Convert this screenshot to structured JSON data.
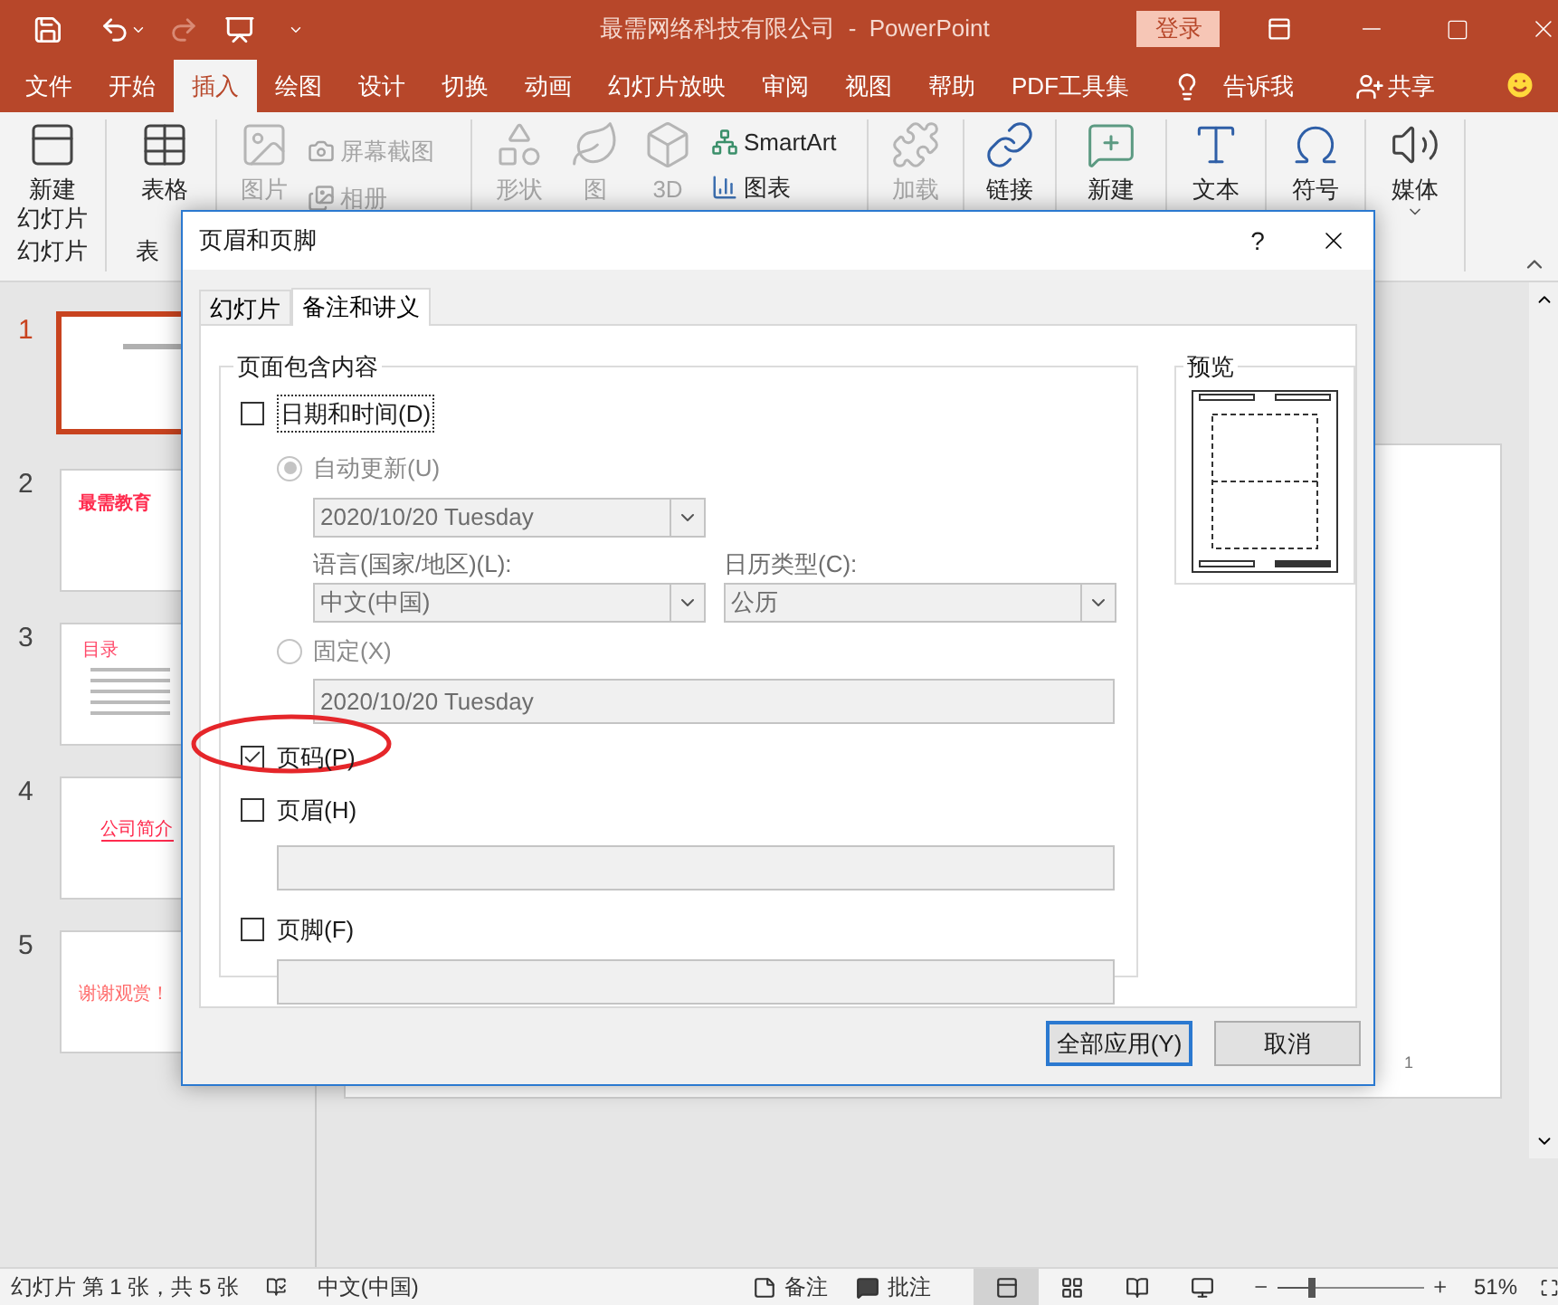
{
  "window": {
    "title": "最需网络科技有限公司  -  PowerPoint",
    "login_button": "登录"
  },
  "menu_tabs": [
    {
      "label": "文件",
      "selected": false
    },
    {
      "label": "开始",
      "selected": false
    },
    {
      "label": "插入",
      "selected": true
    },
    {
      "label": "绘图",
      "selected": false
    },
    {
      "label": "设计",
      "selected": false
    },
    {
      "label": "切换",
      "selected": false
    },
    {
      "label": "动画",
      "selected": false
    },
    {
      "label": "幻灯片放映",
      "selected": false
    },
    {
      "label": "审阅",
      "selected": false
    },
    {
      "label": "视图",
      "selected": false
    },
    {
      "label": "帮助",
      "selected": false
    },
    {
      "label": "PDF工具集",
      "selected": false
    }
  ],
  "tell_me": "告诉我",
  "share": "共享",
  "ribbon": {
    "new_slide": {
      "label": "新建",
      "sublabel": "幻灯片",
      "disabled": false
    },
    "slides_group": "幻灯片",
    "table": {
      "label": "表格",
      "disabled": false
    },
    "table_group": "表",
    "picture": {
      "label": "图片",
      "disabled": true
    },
    "screenshot": {
      "label": "屏幕截图",
      "disabled": true
    },
    "album": {
      "label": "相册",
      "disabled": true
    },
    "shapes": {
      "label": "形状",
      "disabled": true
    },
    "icons": {
      "label": "图",
      "disabled": true
    },
    "models": {
      "label": "3D",
      "disabled": true
    },
    "smartart": {
      "label": "SmartArt",
      "disabled": false
    },
    "chart": {
      "label": "图表",
      "disabled": false
    },
    "addins": {
      "label": "加载",
      "disabled": true
    },
    "link": {
      "label": "链接",
      "disabled": false
    },
    "comment": {
      "label": "新建",
      "disabled": false
    },
    "text": {
      "label": "文本",
      "disabled": false
    },
    "symbol": {
      "label": "符号",
      "disabled": false
    },
    "media": {
      "label": "媒体",
      "disabled": false
    }
  },
  "slides": [
    {
      "number": "1",
      "selected": true,
      "kind": "cover"
    },
    {
      "number": "2",
      "selected": false,
      "kind": "title",
      "title": "最需教育"
    },
    {
      "number": "3",
      "selected": false,
      "kind": "list",
      "title": "目录"
    },
    {
      "number": "4",
      "selected": false,
      "kind": "section",
      "title": "公司简介"
    },
    {
      "number": "5",
      "selected": false,
      "kind": "end",
      "title": "谢谢观赏！"
    }
  ],
  "slide_page_number": "1",
  "dialog": {
    "title": "页眉和页脚",
    "help": "?",
    "tabs": [
      {
        "label": "幻灯片",
        "selected": false
      },
      {
        "label": "备注和讲义",
        "selected": true
      }
    ],
    "group_title": "页面包含内容",
    "date_time": {
      "label": "日期和时间(D)",
      "checked": false
    },
    "auto_update": {
      "label": "自动更新(U)",
      "selected": true,
      "disabled": true
    },
    "date_format": {
      "value": "2020/10/20 Tuesday"
    },
    "language": {
      "label": "语言(国家/地区)(L):",
      "value": "中文(中国)"
    },
    "calendar": {
      "label": "日历类型(C):",
      "value": "公历"
    },
    "fixed": {
      "label": "固定(X)",
      "selected": false,
      "disabled": true,
      "value": "2020/10/20 Tuesday"
    },
    "page_number": {
      "label": "页码(P)",
      "checked": true
    },
    "header": {
      "label": "页眉(H)",
      "checked": false
    },
    "footer": {
      "label": "页脚(F)",
      "checked": false
    },
    "preview_title": "预览",
    "buttons": [
      {
        "label": "全部应用(Y)",
        "primary": true
      },
      {
        "label": "取消",
        "primary": false
      }
    ]
  },
  "status_bar": {
    "slide_info": "幻灯片 第 1 张，共 5 张",
    "language": "中文(中国)",
    "notes": "备注",
    "comments": "批注",
    "views": [
      {
        "selected": true
      },
      {
        "selected": false
      },
      {
        "selected": false
      },
      {
        "selected": false
      }
    ],
    "zoom": {
      "level": 0.24
    },
    "zoom_text": "51%"
  }
}
